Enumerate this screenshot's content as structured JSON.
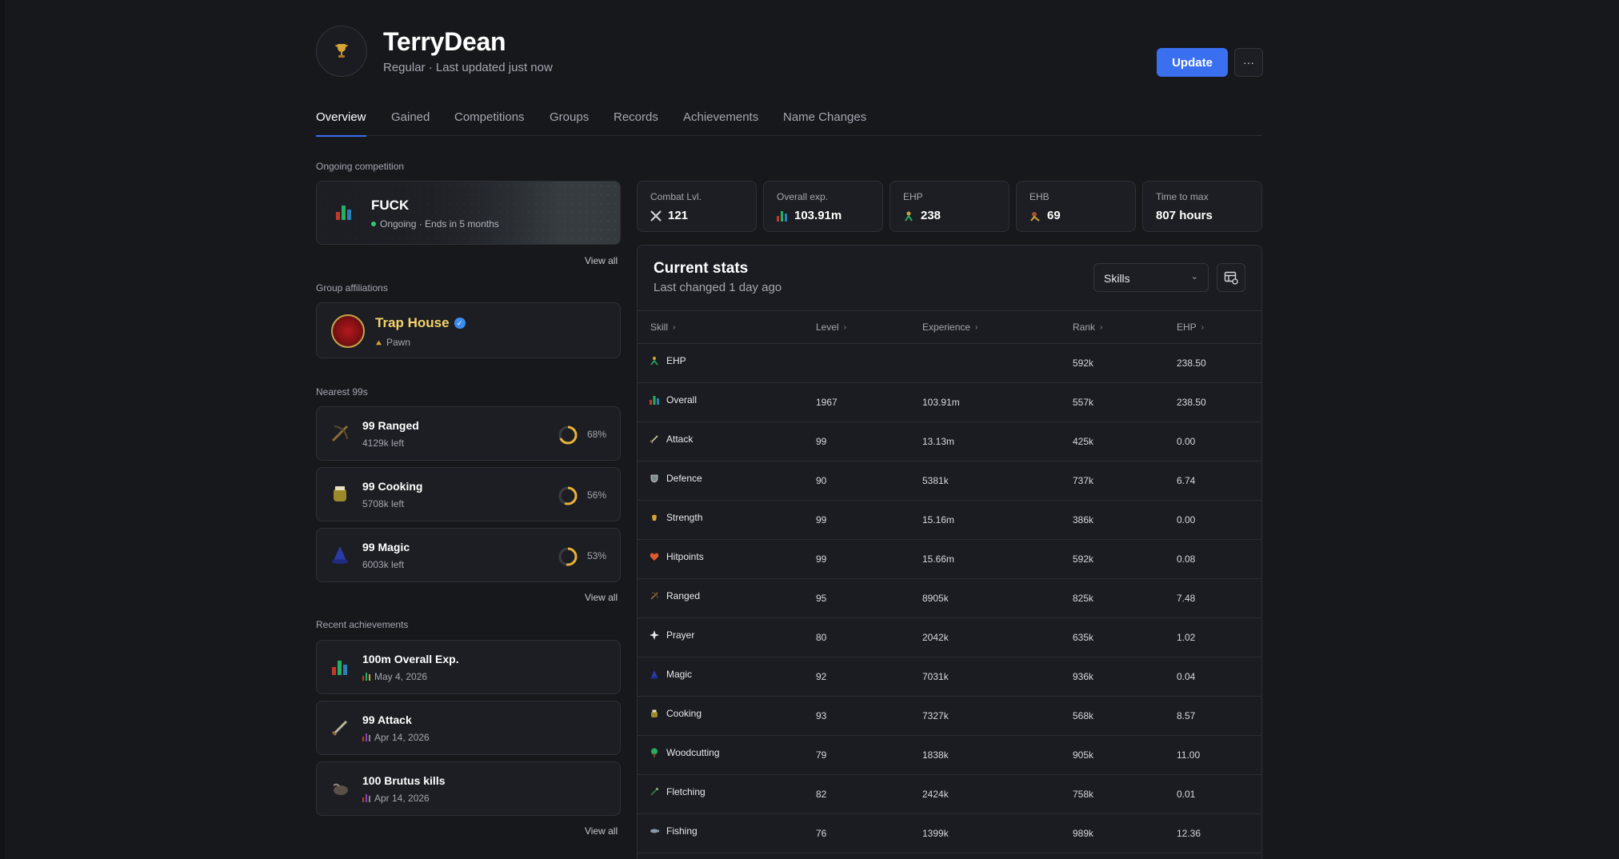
{
  "player": {
    "name": "TerryDean",
    "subtitle": "Regular · Last updated just now",
    "update_label": "Update",
    "more_label": "···"
  },
  "tabs": [
    "Overview",
    "Gained",
    "Competitions",
    "Groups",
    "Records",
    "Achievements",
    "Name Changes"
  ],
  "ongoing": {
    "label": "Ongoing competition",
    "title": "FUCK",
    "status": "Ongoing · Ends in 5 months",
    "view_all": "View all"
  },
  "group": {
    "label": "Group affiliations",
    "name": "Trap House",
    "verified_mark": "✓",
    "role": "Pawn"
  },
  "nearest": {
    "label": "Nearest 99s",
    "items": [
      {
        "title": "99 Ranged",
        "left": "4129k left",
        "pct_label": "68%",
        "pct": 0.68,
        "icon": "ranged-icon"
      },
      {
        "title": "99 Cooking",
        "left": "5708k left",
        "pct_label": "56%",
        "pct": 0.56,
        "icon": "cooking-icon"
      },
      {
        "title": "99 Magic",
        "left": "6003k left",
        "pct_label": "53%",
        "pct": 0.53,
        "icon": "magic-icon"
      }
    ],
    "view_all": "View all"
  },
  "achievements": {
    "label": "Recent achievements",
    "items": [
      {
        "title": "100m Overall Exp.",
        "date": "May 4, 2026",
        "icon": "overall-icon"
      },
      {
        "title": "99 Attack",
        "date": "Apr 14, 2026",
        "icon": "attack-icon"
      },
      {
        "title": "100 Brutus kills",
        "date": "Apr 14, 2026",
        "icon": "brutus-icon"
      }
    ],
    "view_all": "View all"
  },
  "stats_boxes": [
    {
      "label": "Combat Lvl.",
      "value": "121",
      "icon": "combat-icon"
    },
    {
      "label": "Overall exp.",
      "value": "103.91m",
      "icon": "overall-icon"
    },
    {
      "label": "EHP",
      "value": "238",
      "icon": "ehp-icon"
    },
    {
      "label": "EHB",
      "value": "69",
      "icon": "ehb-icon"
    },
    {
      "label": "Time to max",
      "value": "807 hours",
      "icon": ""
    }
  ],
  "current_stats": {
    "title": "Current stats",
    "subtitle": "Last changed 1 day ago",
    "select_value": "Skills",
    "headers": [
      "Skill",
      "Level",
      "Experience",
      "Rank",
      "EHP"
    ],
    "rows": [
      {
        "skill": "EHP",
        "level": "",
        "exp": "",
        "rank": "592k",
        "ehp": "238.50",
        "icon": "ehp-icon"
      },
      {
        "skill": "Overall",
        "level": "1967",
        "exp": "103.91m",
        "rank": "557k",
        "ehp": "238.50",
        "icon": "overall-icon"
      },
      {
        "skill": "Attack",
        "level": "99",
        "exp": "13.13m",
        "rank": "425k",
        "ehp": "0.00",
        "icon": "attack-icon"
      },
      {
        "skill": "Defence",
        "level": "90",
        "exp": "5381k",
        "rank": "737k",
        "ehp": "6.74",
        "icon": "defence-icon"
      },
      {
        "skill": "Strength",
        "level": "99",
        "exp": "15.16m",
        "rank": "386k",
        "ehp": "0.00",
        "icon": "strength-icon"
      },
      {
        "skill": "Hitpoints",
        "level": "99",
        "exp": "15.66m",
        "rank": "592k",
        "ehp": "0.08",
        "icon": "hitpoints-icon"
      },
      {
        "skill": "Ranged",
        "level": "95",
        "exp": "8905k",
        "rank": "825k",
        "ehp": "7.48",
        "icon": "ranged-icon"
      },
      {
        "skill": "Prayer",
        "level": "80",
        "exp": "2042k",
        "rank": "635k",
        "ehp": "1.02",
        "icon": "prayer-icon"
      },
      {
        "skill": "Magic",
        "level": "92",
        "exp": "7031k",
        "rank": "936k",
        "ehp": "0.04",
        "icon": "magic-icon"
      },
      {
        "skill": "Cooking",
        "level": "93",
        "exp": "7327k",
        "rank": "568k",
        "ehp": "8.57",
        "icon": "cooking-icon"
      },
      {
        "skill": "Woodcutting",
        "level": "79",
        "exp": "1838k",
        "rank": "905k",
        "ehp": "11.00",
        "icon": "woodcutting-icon"
      },
      {
        "skill": "Fletching",
        "level": "82",
        "exp": "2424k",
        "rank": "758k",
        "ehp": "0.01",
        "icon": "fletching-icon"
      },
      {
        "skill": "Fishing",
        "level": "76",
        "exp": "1399k",
        "rank": "989k",
        "ehp": "12.36",
        "icon": "fishing-icon"
      }
    ]
  },
  "colors": {
    "accent": "#3a6ff0",
    "gold": "#f4d36a",
    "ring": "#e8b23a",
    "background": "#17181c"
  }
}
